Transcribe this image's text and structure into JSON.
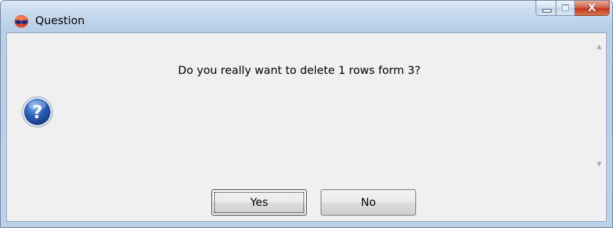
{
  "window": {
    "title": "Question",
    "app_icon": "app-logo-icon",
    "controls": {
      "minimize_icon": "minimize-icon",
      "maximize_icon": "maximize-icon",
      "close_icon": "close-icon",
      "close_glyph": "X"
    }
  },
  "dialog": {
    "icon": "question-icon",
    "message": "Do you really want to delete 1 rows form 3?"
  },
  "scrollbar": {
    "up_icon": "scroll-up-arrow-icon",
    "down_icon": "scroll-down-arrow-icon"
  },
  "buttons": {
    "yes_label": "Yes",
    "no_label": "No",
    "default_button": "Yes"
  },
  "colors": {
    "title_bar": "#c6d9ef",
    "close_button": "#c0391e",
    "question_icon": "#2a5fb5"
  }
}
